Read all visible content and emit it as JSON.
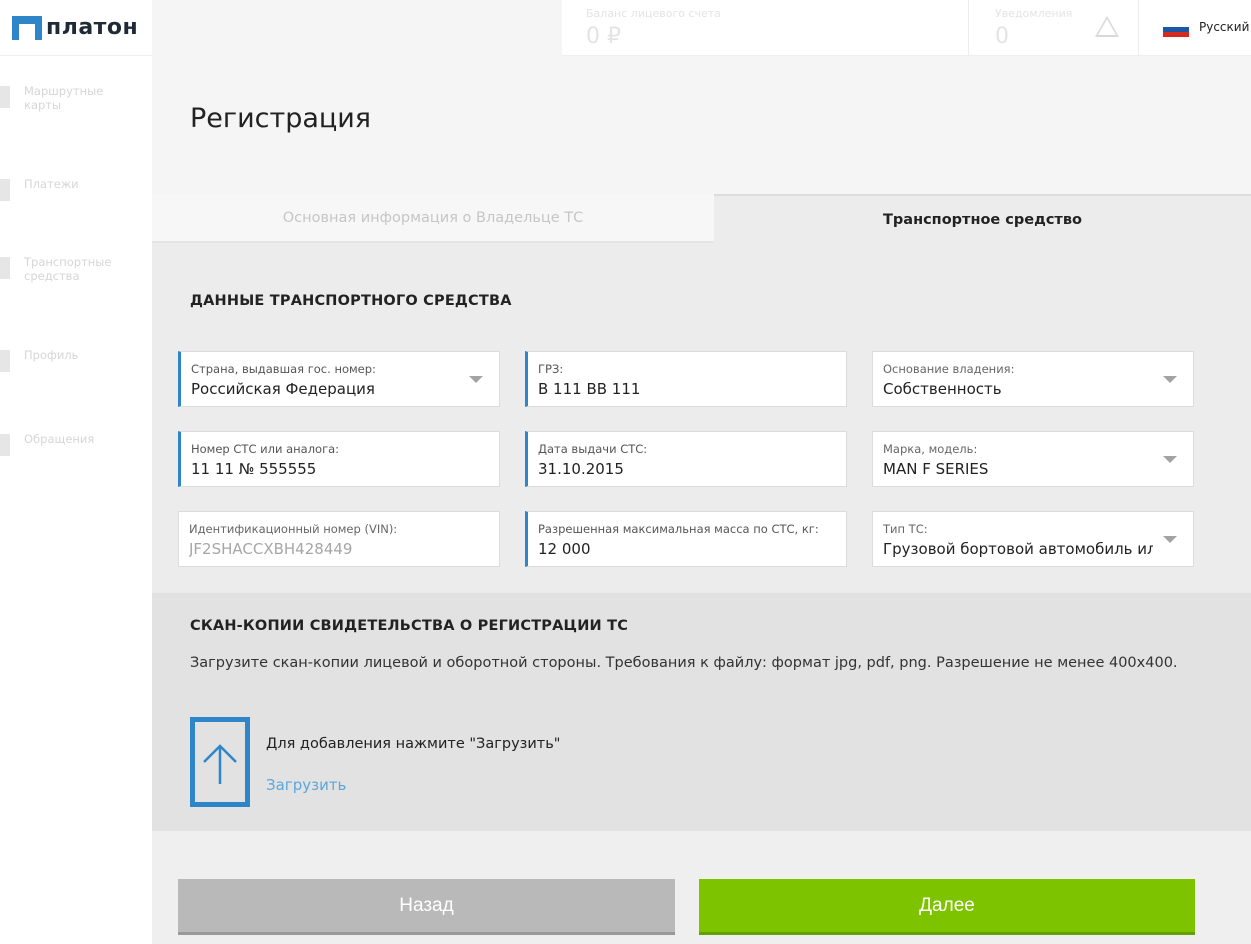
{
  "logo": {
    "text": "платон"
  },
  "sidebar": {
    "items": [
      {
        "label": "Маршрутные карты",
        "icon": "route-map-icon"
      },
      {
        "label": "Платежи",
        "icon": "payments-icon"
      },
      {
        "label": "Транспортные средства",
        "icon": "vehicle-icon"
      },
      {
        "label": "Профиль",
        "icon": "profile-icon"
      },
      {
        "label": "Обращения",
        "icon": "messages-icon"
      }
    ]
  },
  "topbar": {
    "balance_label": "Баланс лицевого счета",
    "balance_value": "0 ₽",
    "notifications_label": "Уведомления",
    "notifications_value": "0",
    "language": "Русский",
    "flag_colors": [
      "#ffffff",
      "#1c57a5",
      "#d52b1e"
    ]
  },
  "page": {
    "title": "Регистрация"
  },
  "tabs": [
    {
      "label": "Основная информация о Владельце ТС",
      "active": false
    },
    {
      "label": "Транспортное средство",
      "active": true
    }
  ],
  "vehicle": {
    "section_title": "ДАННЫЕ ТРАНСПОРТНОГО СРЕДСТВА",
    "fields": {
      "country": {
        "label": "Страна, выдавшая гос. номер:",
        "value": "Российская Федерация"
      },
      "plate": {
        "label": "ГРЗ:",
        "value": "В 111 ВВ 111"
      },
      "ownership": {
        "label": "Основание владения:",
        "value": "Собственность"
      },
      "sts_number": {
        "label": "Номер СТС или аналога:",
        "value": "11 11 № 555555"
      },
      "sts_date": {
        "label": "Дата выдачи СТС:",
        "value": "31.10.2015"
      },
      "make_model": {
        "label": "Марка, модель:",
        "value": "MAN F SERIES"
      },
      "vin": {
        "label": "Идентификационный номер (VIN):",
        "value": "JF2SHACCXBH428449"
      },
      "max_mass": {
        "label": "Разрешенная максимальная масса по СТС, кг:",
        "value": "12 000"
      },
      "vehicle_type": {
        "label": "Тип ТС:",
        "value": "Грузовой бортовой автомобиль или"
      }
    }
  },
  "scan": {
    "section_title": "СКАН-КОПИИ СВИДЕТЕЛЬСТВА О РЕГИСТРАЦИИ ТС",
    "description": "Загрузите скан-копии лицевой и оборотной стороны. Требования к файлу: формат jpg, pdf, png. Разрешение не менее 400x400.",
    "hint": "Для добавления нажмите \"Загрузить\"",
    "upload_label": "Загрузить"
  },
  "buttons": {
    "back": "Назад",
    "next": "Далее"
  },
  "colors": {
    "accent": "#2e86c9",
    "next": "#7dc300",
    "back": "#b9b9b9",
    "link": "#5ba7da"
  }
}
